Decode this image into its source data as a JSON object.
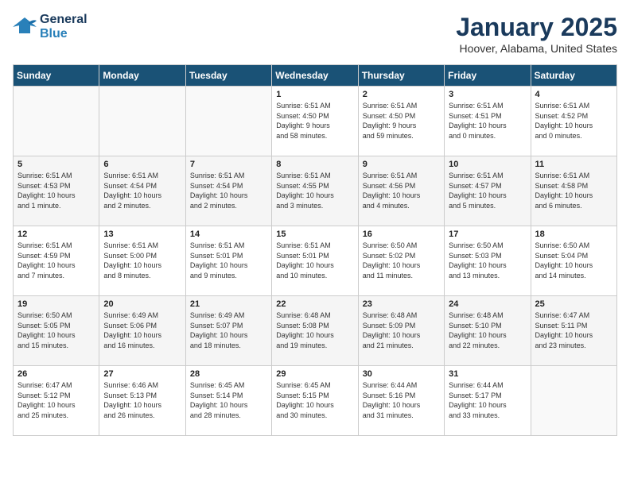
{
  "header": {
    "logo_line1": "General",
    "logo_line2": "Blue",
    "title": "January 2025",
    "subtitle": "Hoover, Alabama, United States"
  },
  "weekdays": [
    "Sunday",
    "Monday",
    "Tuesday",
    "Wednesday",
    "Thursday",
    "Friday",
    "Saturday"
  ],
  "weeks": [
    [
      {
        "num": "",
        "detail": ""
      },
      {
        "num": "",
        "detail": ""
      },
      {
        "num": "",
        "detail": ""
      },
      {
        "num": "1",
        "detail": "Sunrise: 6:51 AM\nSunset: 4:50 PM\nDaylight: 9 hours\nand 58 minutes."
      },
      {
        "num": "2",
        "detail": "Sunrise: 6:51 AM\nSunset: 4:50 PM\nDaylight: 9 hours\nand 59 minutes."
      },
      {
        "num": "3",
        "detail": "Sunrise: 6:51 AM\nSunset: 4:51 PM\nDaylight: 10 hours\nand 0 minutes."
      },
      {
        "num": "4",
        "detail": "Sunrise: 6:51 AM\nSunset: 4:52 PM\nDaylight: 10 hours\nand 0 minutes."
      }
    ],
    [
      {
        "num": "5",
        "detail": "Sunrise: 6:51 AM\nSunset: 4:53 PM\nDaylight: 10 hours\nand 1 minute."
      },
      {
        "num": "6",
        "detail": "Sunrise: 6:51 AM\nSunset: 4:54 PM\nDaylight: 10 hours\nand 2 minutes."
      },
      {
        "num": "7",
        "detail": "Sunrise: 6:51 AM\nSunset: 4:54 PM\nDaylight: 10 hours\nand 2 minutes."
      },
      {
        "num": "8",
        "detail": "Sunrise: 6:51 AM\nSunset: 4:55 PM\nDaylight: 10 hours\nand 3 minutes."
      },
      {
        "num": "9",
        "detail": "Sunrise: 6:51 AM\nSunset: 4:56 PM\nDaylight: 10 hours\nand 4 minutes."
      },
      {
        "num": "10",
        "detail": "Sunrise: 6:51 AM\nSunset: 4:57 PM\nDaylight: 10 hours\nand 5 minutes."
      },
      {
        "num": "11",
        "detail": "Sunrise: 6:51 AM\nSunset: 4:58 PM\nDaylight: 10 hours\nand 6 minutes."
      }
    ],
    [
      {
        "num": "12",
        "detail": "Sunrise: 6:51 AM\nSunset: 4:59 PM\nDaylight: 10 hours\nand 7 minutes."
      },
      {
        "num": "13",
        "detail": "Sunrise: 6:51 AM\nSunset: 5:00 PM\nDaylight: 10 hours\nand 8 minutes."
      },
      {
        "num": "14",
        "detail": "Sunrise: 6:51 AM\nSunset: 5:01 PM\nDaylight: 10 hours\nand 9 minutes."
      },
      {
        "num": "15",
        "detail": "Sunrise: 6:51 AM\nSunset: 5:01 PM\nDaylight: 10 hours\nand 10 minutes."
      },
      {
        "num": "16",
        "detail": "Sunrise: 6:50 AM\nSunset: 5:02 PM\nDaylight: 10 hours\nand 11 minutes."
      },
      {
        "num": "17",
        "detail": "Sunrise: 6:50 AM\nSunset: 5:03 PM\nDaylight: 10 hours\nand 13 minutes."
      },
      {
        "num": "18",
        "detail": "Sunrise: 6:50 AM\nSunset: 5:04 PM\nDaylight: 10 hours\nand 14 minutes."
      }
    ],
    [
      {
        "num": "19",
        "detail": "Sunrise: 6:50 AM\nSunset: 5:05 PM\nDaylight: 10 hours\nand 15 minutes."
      },
      {
        "num": "20",
        "detail": "Sunrise: 6:49 AM\nSunset: 5:06 PM\nDaylight: 10 hours\nand 16 minutes."
      },
      {
        "num": "21",
        "detail": "Sunrise: 6:49 AM\nSunset: 5:07 PM\nDaylight: 10 hours\nand 18 minutes."
      },
      {
        "num": "22",
        "detail": "Sunrise: 6:48 AM\nSunset: 5:08 PM\nDaylight: 10 hours\nand 19 minutes."
      },
      {
        "num": "23",
        "detail": "Sunrise: 6:48 AM\nSunset: 5:09 PM\nDaylight: 10 hours\nand 21 minutes."
      },
      {
        "num": "24",
        "detail": "Sunrise: 6:48 AM\nSunset: 5:10 PM\nDaylight: 10 hours\nand 22 minutes."
      },
      {
        "num": "25",
        "detail": "Sunrise: 6:47 AM\nSunset: 5:11 PM\nDaylight: 10 hours\nand 23 minutes."
      }
    ],
    [
      {
        "num": "26",
        "detail": "Sunrise: 6:47 AM\nSunset: 5:12 PM\nDaylight: 10 hours\nand 25 minutes."
      },
      {
        "num": "27",
        "detail": "Sunrise: 6:46 AM\nSunset: 5:13 PM\nDaylight: 10 hours\nand 26 minutes."
      },
      {
        "num": "28",
        "detail": "Sunrise: 6:45 AM\nSunset: 5:14 PM\nDaylight: 10 hours\nand 28 minutes."
      },
      {
        "num": "29",
        "detail": "Sunrise: 6:45 AM\nSunset: 5:15 PM\nDaylight: 10 hours\nand 30 minutes."
      },
      {
        "num": "30",
        "detail": "Sunrise: 6:44 AM\nSunset: 5:16 PM\nDaylight: 10 hours\nand 31 minutes."
      },
      {
        "num": "31",
        "detail": "Sunrise: 6:44 AM\nSunset: 5:17 PM\nDaylight: 10 hours\nand 33 minutes."
      },
      {
        "num": "",
        "detail": ""
      }
    ]
  ]
}
